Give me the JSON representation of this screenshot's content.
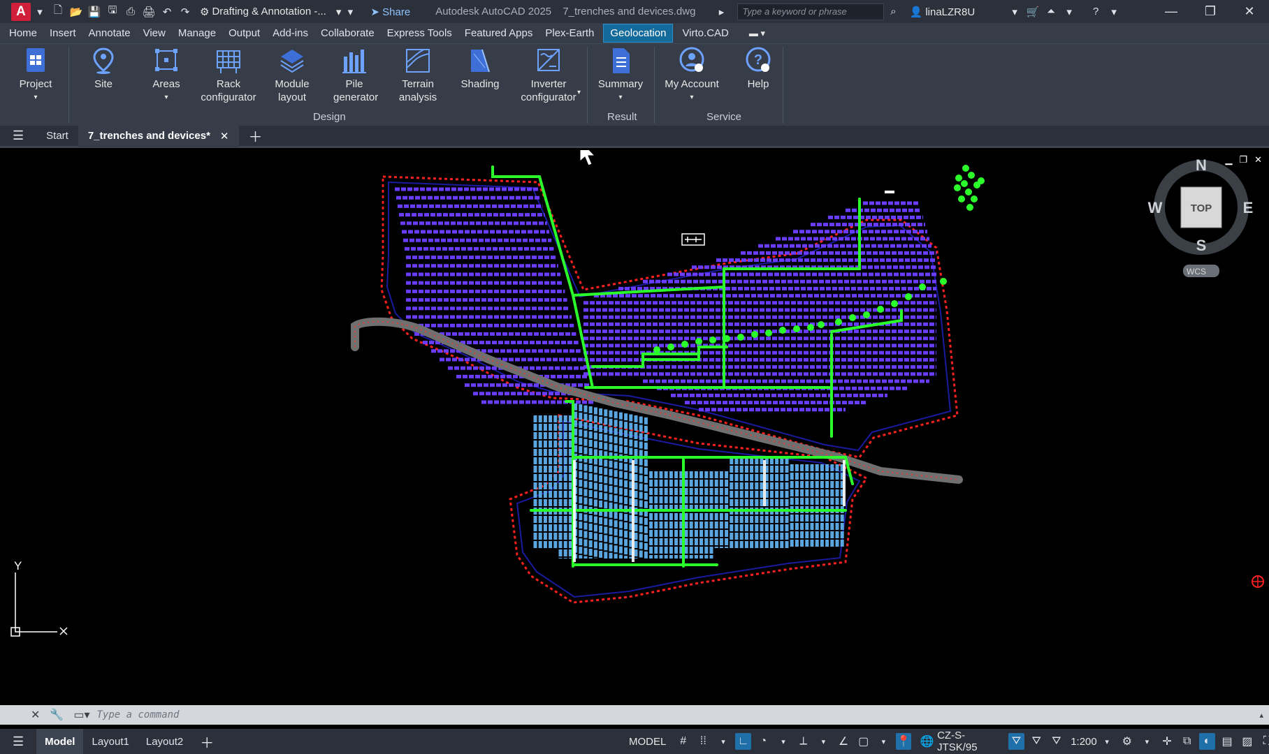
{
  "titlebar": {
    "app_letter": "A",
    "workspace": "Drafting & Annotation -...",
    "share": "Share",
    "app_name": "Autodesk AutoCAD 2025",
    "file_name": "7_trenches and devices.dwg",
    "search_placeholder": "Type a keyword or phrase",
    "user": "linaLZR8U"
  },
  "menu": {
    "tabs": [
      "Home",
      "Insert",
      "Annotate",
      "View",
      "Manage",
      "Output",
      "Add-ins",
      "Collaborate",
      "Express Tools",
      "Featured Apps",
      "Plex-Earth",
      "Geolocation",
      "Virto.CAD"
    ],
    "active": "Geolocation"
  },
  "ribbon": {
    "buttons": [
      {
        "label": "Project",
        "icon": "project-icon"
      },
      {
        "label": "Site",
        "icon": "site-pin-icon"
      },
      {
        "label": "Areas",
        "icon": "areas-icon"
      },
      {
        "label": "Rack configurator",
        "icon": "rack-icon"
      },
      {
        "label": "Module layout",
        "icon": "module-layout-icon"
      },
      {
        "label": "Pile generator",
        "icon": "pile-icon"
      },
      {
        "label": "Terrain analysis",
        "icon": "terrain-icon"
      },
      {
        "label": "Shading",
        "icon": "shading-icon"
      },
      {
        "label": "Inverter configurator",
        "icon": "inverter-icon"
      },
      {
        "label": "Summary",
        "icon": "summary-icon"
      },
      {
        "label": "My Account",
        "icon": "account-icon"
      },
      {
        "label": "Help",
        "icon": "help-icon"
      }
    ],
    "panels": [
      "Design",
      "Result",
      "Service"
    ]
  },
  "doc_tabs": {
    "start": "Start",
    "active": "7_trenches and devices*"
  },
  "viewcube": {
    "north": "N",
    "south": "S",
    "east": "E",
    "west": "W",
    "face": "TOP",
    "wcs": "WCS"
  },
  "ucs": {
    "y_label": "Y"
  },
  "command": {
    "placeholder": "Type a command"
  },
  "layout_tabs": [
    "Model",
    "Layout1",
    "Layout2"
  ],
  "status": {
    "model": "MODEL",
    "coordinate_system": "CZ-S-JTSK/95",
    "scale": "1:200"
  },
  "colors": {
    "boundary": "#ff2020",
    "trench": "#2bff2b",
    "panels_upper": "#6a3cff",
    "panels_lower": "#5aa6e0",
    "road": "#808080",
    "accent": "#1f6fa8"
  }
}
